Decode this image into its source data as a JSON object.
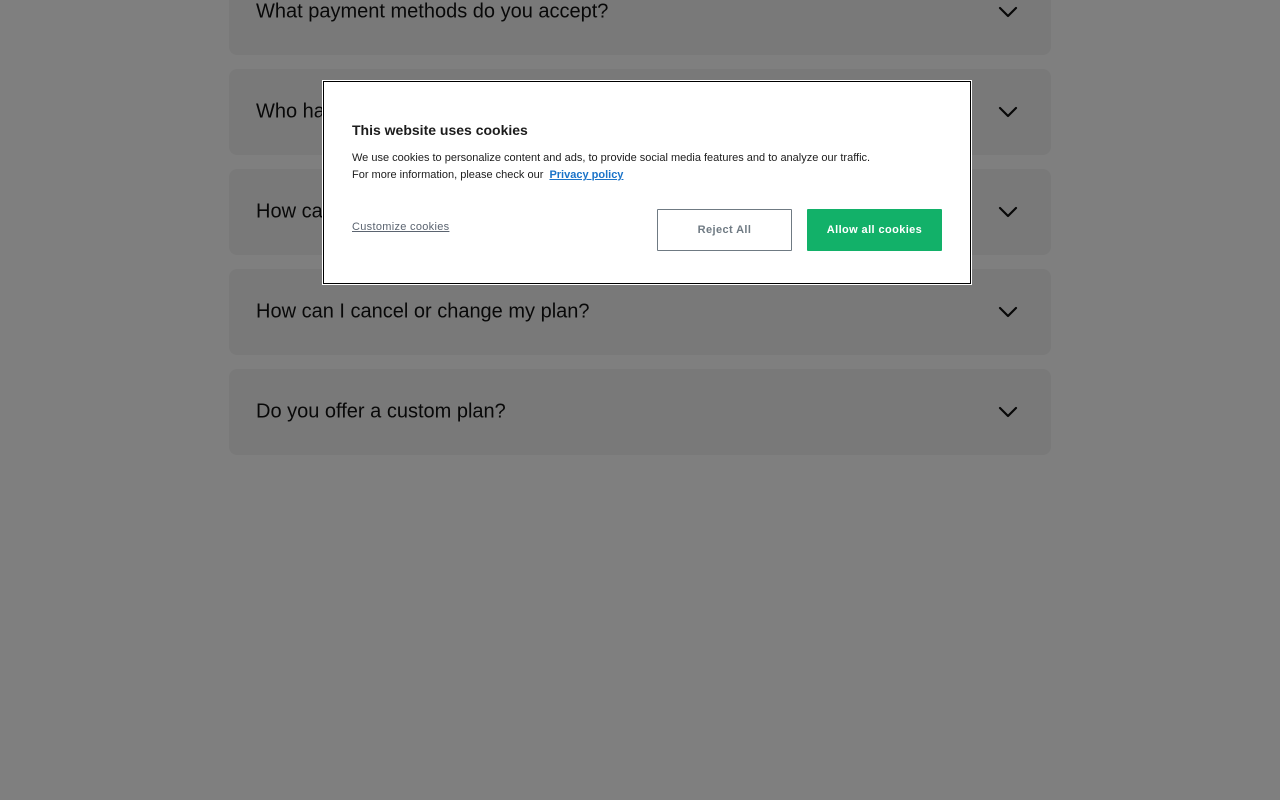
{
  "faq": {
    "items": [
      {
        "question": "What payment methods do you accept?"
      },
      {
        "question": "Who ha"
      },
      {
        "question": "How ca"
      },
      {
        "question": "How can I cancel or change my plan?"
      },
      {
        "question": "Do you offer a custom plan?"
      }
    ]
  },
  "cookie_banner": {
    "title": "This website uses cookies",
    "body_line1": "We use cookies to personalize content and ads, to provide social media features and to analyze our traffic.",
    "body_line2": "For more information, please check our",
    "privacy_link": "Privacy policy",
    "customize_label": "Customize cookies",
    "reject_label": "Reject All",
    "allow_label": "Allow all cookies"
  },
  "colors": {
    "accent": "#12b169",
    "link": "#1a73c8",
    "overlay": "rgba(0,0,0,0.5)"
  },
  "icons": {
    "faq_toggle": "chevron-down-icon"
  }
}
